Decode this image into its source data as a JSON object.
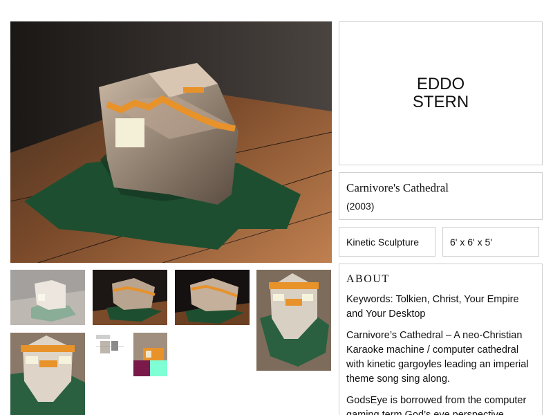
{
  "artist": {
    "first_name": "EDDO",
    "last_name": "STERN"
  },
  "work": {
    "title": "Carnivore's Cathedral",
    "year": "(2003)",
    "medium": "Kinetic Sculpture",
    "dimensions": "6' x 6' x 5'"
  },
  "about": {
    "heading": "ABOUT",
    "keywords": "Keywords: Tolkien, Christ, Your Empire and Your Desktop",
    "paragraph_1": "Carnivore’s Cathedral – A neo-Christian Karaoke machine / computer cathedral with kinetic gargoyles leading an imperial theme song sing along.",
    "paragraph_2": "GodsEye is borrowed from the computer gaming term God’s eye perspective"
  },
  "colors": {
    "border": "#cfcfcf",
    "floor_green": "#1f5a36",
    "banner_orange": "#e8922a",
    "wall_dark": "#2a2522"
  }
}
